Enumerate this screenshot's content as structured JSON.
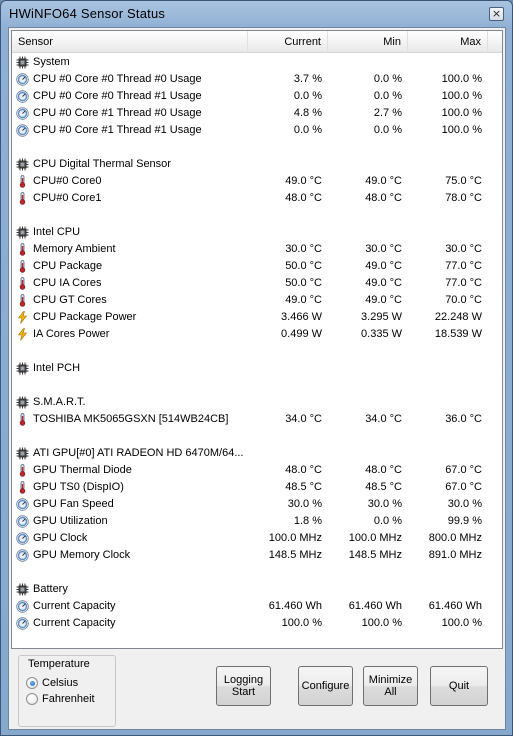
{
  "window": {
    "title": "HWiNFO64 Sensor Status",
    "close_label": "×"
  },
  "columns": {
    "sensor": "Sensor",
    "current": "Current",
    "min": "Min",
    "max": "Max"
  },
  "rows": [
    {
      "type": "group",
      "icon": "chip-icon",
      "name": "System",
      "cur": "",
      "min": "",
      "max": ""
    },
    {
      "type": "item",
      "icon": "gauge-icon",
      "name": "CPU #0 Core #0 Thread #0 Usage",
      "cur": "3.7 %",
      "min": "0.0 %",
      "max": "100.0 %"
    },
    {
      "type": "item",
      "icon": "gauge-icon",
      "name": "CPU #0 Core #0 Thread #1 Usage",
      "cur": "0.0 %",
      "min": "0.0 %",
      "max": "100.0 %"
    },
    {
      "type": "item",
      "icon": "gauge-icon",
      "name": "CPU #0 Core #1 Thread #0 Usage",
      "cur": "4.8 %",
      "min": "2.7 %",
      "max": "100.0 %"
    },
    {
      "type": "item",
      "icon": "gauge-icon",
      "name": "CPU #0 Core #1 Thread #1 Usage",
      "cur": "0.0 %",
      "min": "0.0 %",
      "max": "100.0 %"
    },
    {
      "type": "blank",
      "icon": "",
      "name": "",
      "cur": "",
      "min": "",
      "max": ""
    },
    {
      "type": "group",
      "icon": "chip-icon",
      "name": "CPU Digital Thermal Sensor",
      "cur": "",
      "min": "",
      "max": ""
    },
    {
      "type": "item",
      "icon": "thermometer-icon",
      "name": "CPU#0 Core0",
      "cur": "49.0 °C",
      "min": "49.0 °C",
      "max": "75.0 °C"
    },
    {
      "type": "item",
      "icon": "thermometer-icon",
      "name": "CPU#0 Core1",
      "cur": "48.0 °C",
      "min": "48.0 °C",
      "max": "78.0 °C"
    },
    {
      "type": "blank",
      "icon": "",
      "name": "",
      "cur": "",
      "min": "",
      "max": ""
    },
    {
      "type": "group",
      "icon": "chip-icon",
      "name": "Intel CPU",
      "cur": "",
      "min": "",
      "max": ""
    },
    {
      "type": "item",
      "icon": "thermometer-icon",
      "name": "Memory Ambient",
      "cur": "30.0 °C",
      "min": "30.0 °C",
      "max": "30.0 °C"
    },
    {
      "type": "item",
      "icon": "thermometer-icon",
      "name": "CPU Package",
      "cur": "50.0 °C",
      "min": "49.0 °C",
      "max": "77.0 °C"
    },
    {
      "type": "item",
      "icon": "thermometer-icon",
      "name": "CPU IA Cores",
      "cur": "50.0 °C",
      "min": "49.0 °C",
      "max": "77.0 °C"
    },
    {
      "type": "item",
      "icon": "thermometer-icon",
      "name": "CPU GT Cores",
      "cur": "49.0 °C",
      "min": "49.0 °C",
      "max": "70.0 °C"
    },
    {
      "type": "item",
      "icon": "lightning-icon",
      "name": "CPU Package Power",
      "cur": "3.466 W",
      "min": "3.295 W",
      "max": "22.248 W"
    },
    {
      "type": "item",
      "icon": "lightning-icon",
      "name": "IA Cores Power",
      "cur": "0.499 W",
      "min": "0.335 W",
      "max": "18.539 W"
    },
    {
      "type": "blank",
      "icon": "",
      "name": "",
      "cur": "",
      "min": "",
      "max": ""
    },
    {
      "type": "group",
      "icon": "chip-icon",
      "name": "Intel PCH",
      "cur": "",
      "min": "",
      "max": ""
    },
    {
      "type": "blank",
      "icon": "",
      "name": "",
      "cur": "",
      "min": "",
      "max": ""
    },
    {
      "type": "group",
      "icon": "chip-icon",
      "name": "S.M.A.R.T.",
      "cur": "",
      "min": "",
      "max": ""
    },
    {
      "type": "item",
      "icon": "thermometer-icon",
      "name": "TOSHIBA MK5065GSXN [514WB24CB]",
      "cur": "34.0 °C",
      "min": "34.0 °C",
      "max": "36.0 °C"
    },
    {
      "type": "blank",
      "icon": "",
      "name": "",
      "cur": "",
      "min": "",
      "max": ""
    },
    {
      "type": "group",
      "icon": "chip-icon",
      "name": "ATI GPU[#0] ATI RADEON HD 6470M/64...",
      "cur": "",
      "min": "",
      "max": ""
    },
    {
      "type": "item",
      "icon": "thermometer-icon",
      "name": "GPU Thermal Diode",
      "cur": "48.0 °C",
      "min": "48.0 °C",
      "max": "67.0 °C"
    },
    {
      "type": "item",
      "icon": "thermometer-icon",
      "name": "GPU TS0 (DispIO)",
      "cur": "48.5 °C",
      "min": "48.5 °C",
      "max": "67.0 °C"
    },
    {
      "type": "item",
      "icon": "gauge-icon",
      "name": "GPU Fan Speed",
      "cur": "30.0 %",
      "min": "30.0 %",
      "max": "30.0 %"
    },
    {
      "type": "item",
      "icon": "gauge-icon",
      "name": "GPU Utilization",
      "cur": "1.8 %",
      "min": "0.0 %",
      "max": "99.9 %"
    },
    {
      "type": "item",
      "icon": "gauge-icon",
      "name": "GPU Clock",
      "cur": "100.0 MHz",
      "min": "100.0 MHz",
      "max": "800.0 MHz"
    },
    {
      "type": "item",
      "icon": "gauge-icon",
      "name": "GPU Memory Clock",
      "cur": "148.5 MHz",
      "min": "148.5 MHz",
      "max": "891.0 MHz"
    },
    {
      "type": "blank",
      "icon": "",
      "name": "",
      "cur": "",
      "min": "",
      "max": ""
    },
    {
      "type": "group",
      "icon": "chip-icon",
      "name": "Battery",
      "cur": "",
      "min": "",
      "max": ""
    },
    {
      "type": "item",
      "icon": "gauge-icon",
      "name": "Current Capacity",
      "cur": "61.460 Wh",
      "min": "61.460 Wh",
      "max": "61.460 Wh"
    },
    {
      "type": "item",
      "icon": "gauge-icon",
      "name": "Current Capacity",
      "cur": "100.0 %",
      "min": "100.0 %",
      "max": "100.0 %"
    }
  ],
  "temperature": {
    "legend": "Temperature",
    "options": [
      {
        "label": "Celsius",
        "selected": true
      },
      {
        "label": "Fahrenheit",
        "selected": false
      }
    ]
  },
  "buttons": {
    "logging_line1": "Logging",
    "logging_line2": "Start",
    "configure": "Configure",
    "minimize_line1": "Minimize",
    "minimize_line2": "All",
    "quit": "Quit"
  },
  "colors": {
    "thermometer": "#c0232a",
    "lightning": "#f2b705",
    "gauge": "#5d8fc7",
    "chip": "#3a3a3a"
  }
}
